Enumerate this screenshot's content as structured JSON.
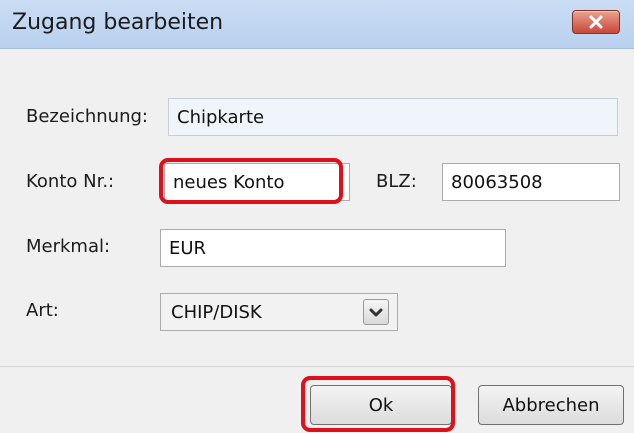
{
  "window": {
    "title": "Zugang bearbeiten"
  },
  "form": {
    "bezeichnung": {
      "label": "Bezeichnung:",
      "value": "Chipkarte"
    },
    "konto": {
      "label": "Konto Nr.:",
      "value": "neues Konto"
    },
    "blz": {
      "label": "BLZ:",
      "value": "80063508"
    },
    "merkmal": {
      "label": "Merkmal:",
      "value": "EUR"
    },
    "art": {
      "label": "Art:",
      "value": "CHIP/DISK"
    }
  },
  "buttons": {
    "ok": "Ok",
    "cancel": "Abbrechen"
  },
  "colors": {
    "highlight": "#e0101a",
    "titlebar": "#c9dcf3"
  }
}
